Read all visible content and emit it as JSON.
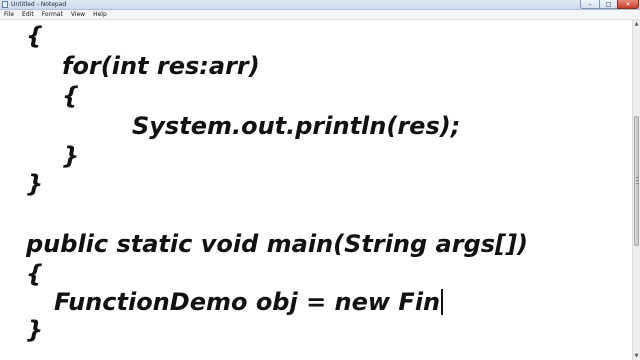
{
  "window": {
    "title": "Untitled - Notepad",
    "controls": {
      "minimize": "–",
      "maximize": "□",
      "close": "✕"
    }
  },
  "menu": [
    "File",
    "Edit",
    "Format",
    "View",
    "Help"
  ],
  "editor": {
    "lines": [
      "{",
      "for(int res:arr)",
      "{",
      "System.out.println(res);",
      "}",
      "}",
      "public static void main(String args[])",
      "{",
      "FunctionDemo obj = new Fin",
      "}"
    ]
  },
  "scrollbar": {
    "up_arrow": "▲",
    "down_arrow": "▼"
  },
  "icons": {
    "app": "notepad-icon"
  }
}
